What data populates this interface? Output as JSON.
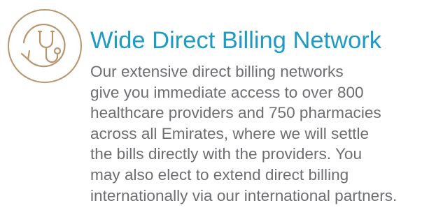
{
  "colors": {
    "title": "#1d9bc4",
    "body_text": "#6d6e71",
    "icon": "#b9956e",
    "background": "#ffffff"
  },
  "feature": {
    "icon": "stethoscope-cycle-icon",
    "title": "Wide Direct Billing Network",
    "description_lines": [
      "Our extensive direct billing networks",
      "give you immediate access to over 800",
      "healthcare providers and 750 pharmacies",
      "across all Emirates, where we will settle",
      "the bills directly with the providers. You",
      "may also elect to extend direct billing",
      "internationally via our international partners."
    ]
  }
}
